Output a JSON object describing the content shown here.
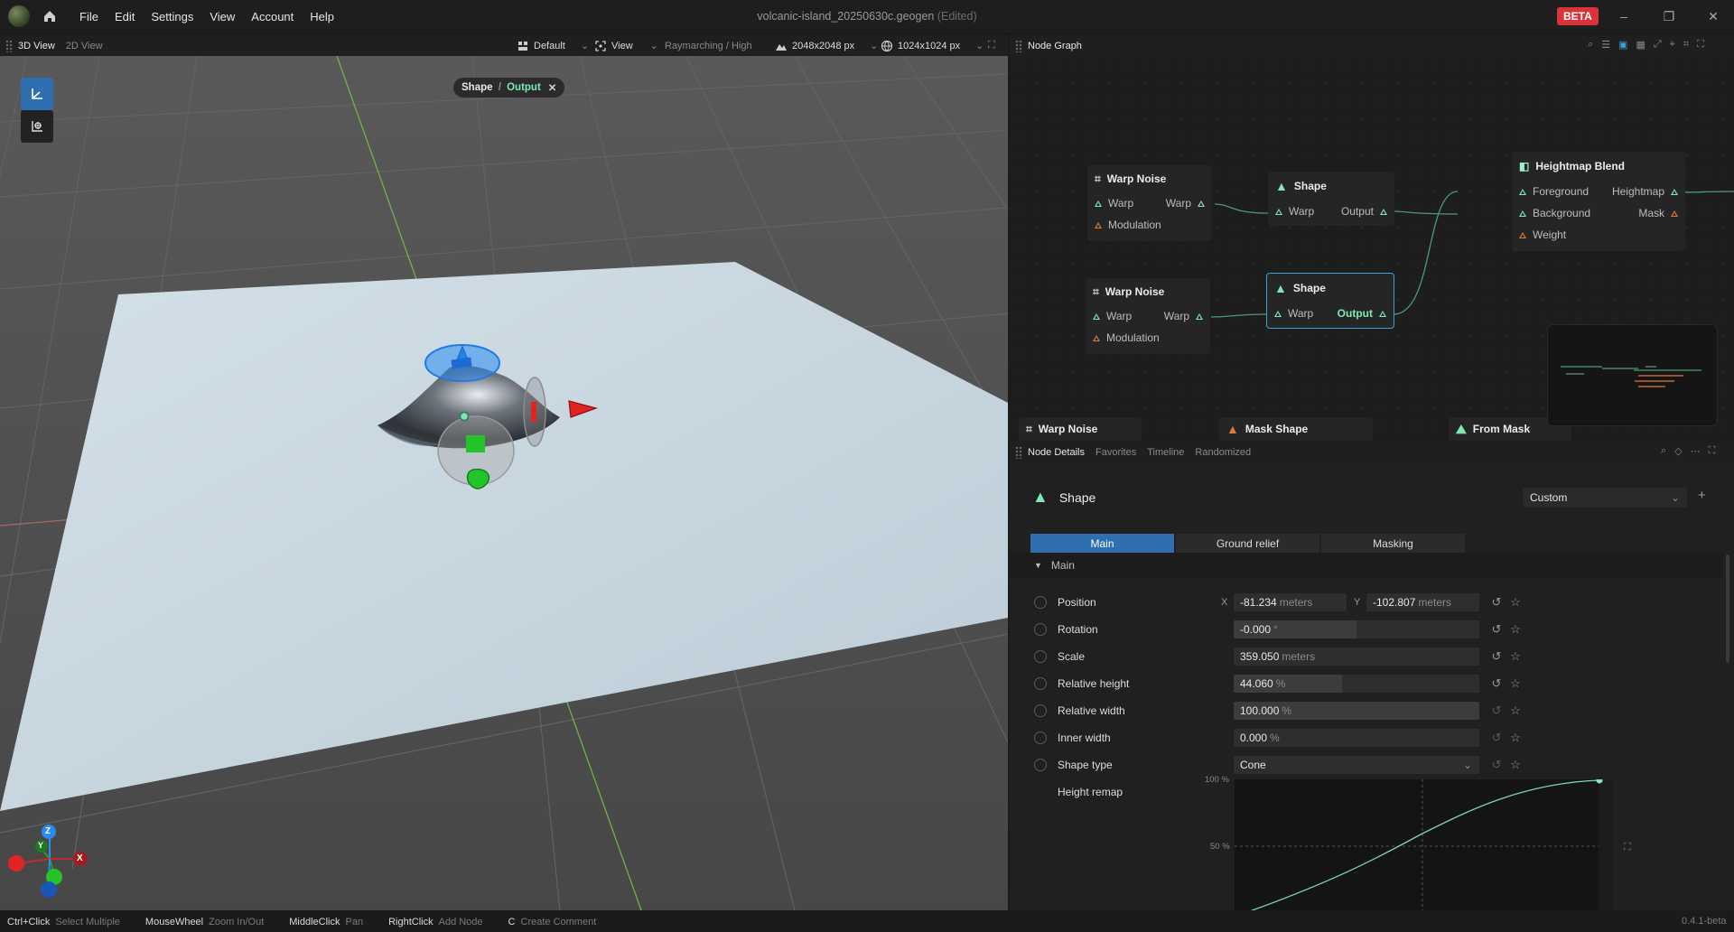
{
  "window": {
    "menu": [
      "File",
      "Edit",
      "Settings",
      "View",
      "Account",
      "Help"
    ],
    "file_name": "volcanic-island_20250630c.geogen",
    "edited_flag": "(Edited)",
    "beta_badge": "BETA",
    "minimize": "–",
    "maximize": "❐",
    "close": "✕"
  },
  "viewport": {
    "tabs": [
      "3D View",
      "2D View"
    ],
    "active_tab": "3D View",
    "toolbar": {
      "layout": "Default",
      "view": "View",
      "render_mode": "Raymarching / High",
      "resolution": "2048x2048 px",
      "preview_resolution": "1024x1024 px"
    },
    "breadcrumb": {
      "node": "Shape",
      "separator": " / ",
      "port": "Output"
    },
    "axes": {
      "x": "X",
      "y": "Y",
      "z": "Z"
    }
  },
  "node_graph": {
    "title": "Node Graph",
    "nodes": {
      "warp_noise_1": {
        "title": "Warp Noise",
        "in_warp": "Warp",
        "out_warp": "Warp",
        "modulation": "Modulation"
      },
      "shape_1": {
        "title": "Shape",
        "in_warp": "Warp",
        "output": "Output"
      },
      "heightmap_blend": {
        "title": "Heightmap Blend",
        "foreground": "Foreground",
        "heightmap": "Heightmap",
        "background": "Background",
        "mask": "Mask",
        "weight": "Weight"
      },
      "warp_noise_2": {
        "title": "Warp Noise",
        "in_warp": "Warp",
        "out_warp": "Warp",
        "modulation": "Modulation"
      },
      "shape_2": {
        "title": "Shape",
        "in_warp": "Warp",
        "output": "Output"
      },
      "warp_noise_3": {
        "title": "Warp Noise"
      },
      "mask_shape": {
        "title": "Mask Shape"
      },
      "from_mask": {
        "title": "From Mask"
      }
    }
  },
  "node_details": {
    "tabs": [
      "Node Details",
      "Favorites",
      "Timeline",
      "Randomized"
    ],
    "active_tab": "Node Details",
    "node_title": "Shape",
    "preset": "Custom",
    "subtabs": [
      "Main",
      "Ground relief",
      "Masking"
    ],
    "active_subtab": "Main",
    "section": "Main",
    "properties": {
      "position": {
        "label": "Position",
        "x_label": "X",
        "x": "-81.234",
        "x_unit": "meters",
        "y_label": "Y",
        "y": "-102.807",
        "y_unit": "meters"
      },
      "rotation": {
        "label": "Rotation",
        "value": "-0.000",
        "unit": "°",
        "fill": 0.5
      },
      "scale": {
        "label": "Scale",
        "value": "359.050",
        "unit": "meters"
      },
      "relative_height": {
        "label": "Relative height",
        "value": "44.060",
        "unit": "%",
        "fill": 0.44
      },
      "relative_width": {
        "label": "Relative width",
        "value": "100.000",
        "unit": "%",
        "fill": 1.0
      },
      "inner_width": {
        "label": "Inner width",
        "value": "0.000",
        "unit": "%",
        "fill": 0
      },
      "shape_type": {
        "label": "Shape type",
        "value": "Cone"
      },
      "height_remap": {
        "label": "Height remap",
        "tick_100": "100 %",
        "tick_50": "50 %"
      }
    }
  },
  "status_bar": [
    {
      "key": "Ctrl+Click",
      "value": "Select Multiple"
    },
    {
      "key": "MouseWheel",
      "value": "Zoom In/Out"
    },
    {
      "key": "MiddleClick",
      "value": "Pan"
    },
    {
      "key": "RightClick",
      "value": "Add Node"
    },
    {
      "key": "C",
      "value": "Create Comment"
    }
  ],
  "version": "0.4.1-beta",
  "colors": {
    "accent": "#2f6fb0",
    "port_green": "#7fe8b5",
    "port_orange": "#e07a3a",
    "beta_red": "#d8323a",
    "terrain": "#c7d6e0"
  }
}
